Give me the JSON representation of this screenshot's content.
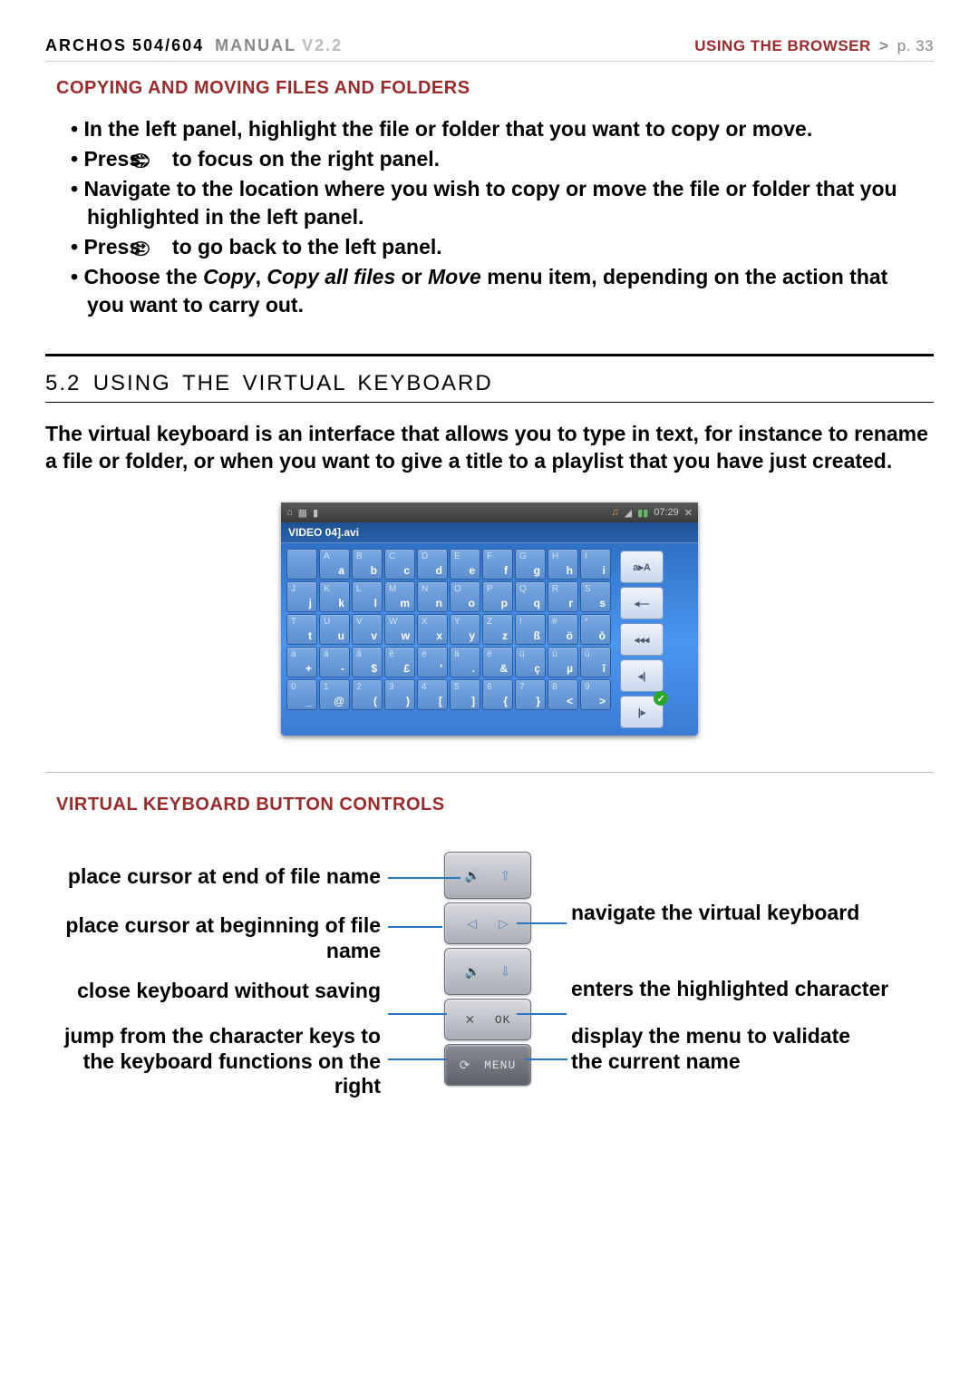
{
  "header": {
    "brand": "ARCHOS",
    "model": "504/604",
    "manual_word": "MANUAL",
    "version": "V2.2",
    "section": "USING THE BROWSER",
    "page_label": "p. 33"
  },
  "sub_heading_copy": "COPYING AND MOVING FILES AND FOLDERS",
  "bullets": [
    {
      "pre": "In the left panel, highlight the file or folder that you want to copy or move."
    },
    {
      "pre": "Press ",
      "icon": "swap",
      "post": " to focus on the right panel."
    },
    {
      "pre": "Navigate to the location where you wish to copy or move the file or folder that you highlighted in the left panel."
    },
    {
      "pre": "Press ",
      "icon": "swap",
      "post": " to go back to the left panel."
    },
    {
      "pre": "Choose the ",
      "em1": "Copy",
      "mid1": ", ",
      "em2": "Copy all files",
      "mid2": " or ",
      "em3": "Move",
      "post": " menu item, depending on the action that you want to carry out."
    }
  ],
  "section_52_num": "5.2",
  "section_52_title": "USING THE VIRTUAL KEYBOARD",
  "intro_paragraph": "The virtual keyboard is an interface that allows you to type in text, for instance to rename a file or folder, or when you want to give a title to a playlist that you have just created.",
  "vk": {
    "time": "07:29",
    "filename": "VIDEO 04].avi",
    "rows": [
      [
        [
          "",
          ""
        ],
        [
          "A",
          "a"
        ],
        [
          "B",
          "b"
        ],
        [
          "C",
          "c"
        ],
        [
          "D",
          "d"
        ],
        [
          "E",
          "e"
        ],
        [
          "F",
          "f"
        ],
        [
          "G",
          "g"
        ],
        [
          "H",
          "h"
        ],
        [
          "I",
          "i"
        ]
      ],
      [
        [
          "J",
          "j"
        ],
        [
          "K",
          "k"
        ],
        [
          "L",
          "l"
        ],
        [
          "M",
          "m"
        ],
        [
          "N",
          "n"
        ],
        [
          "O",
          "o"
        ],
        [
          "P",
          "p"
        ],
        [
          "Q",
          "q"
        ],
        [
          "R",
          "r"
        ],
        [
          "S",
          "s"
        ]
      ],
      [
        [
          "T",
          "t"
        ],
        [
          "U",
          "u"
        ],
        [
          "V",
          "v"
        ],
        [
          "W",
          "w"
        ],
        [
          "X",
          "x"
        ],
        [
          "Y",
          "y"
        ],
        [
          "Z",
          "z"
        ],
        [
          "!",
          "ß"
        ],
        [
          "#",
          "ö"
        ],
        [
          "*",
          "ō"
        ]
      ],
      [
        [
          "à",
          "+"
        ],
        [
          "á",
          "-"
        ],
        [
          "â",
          "$"
        ],
        [
          "ê",
          "£"
        ],
        [
          "è",
          "'"
        ],
        [
          "ä",
          "."
        ],
        [
          "ë",
          "&"
        ],
        [
          "ü",
          "ç"
        ],
        [
          "ù",
          "µ"
        ],
        [
          "ú",
          "î"
        ]
      ],
      [
        [
          "0",
          "_"
        ],
        [
          "1",
          "@"
        ],
        [
          "2",
          "("
        ],
        [
          "3",
          ")"
        ],
        [
          "4",
          "["
        ],
        [
          "5",
          "]"
        ],
        [
          "6",
          "{"
        ],
        [
          "7",
          "}"
        ],
        [
          "8",
          "<"
        ],
        [
          "9",
          ">"
        ]
      ]
    ],
    "side": [
      "a▸A",
      "◂—",
      "◂◂◂",
      "◂|",
      "|▸"
    ]
  },
  "sub_heading_controls": "VIRTUAL KEYBOARD BUTTON CONTROLS",
  "controls": {
    "left": [
      "place cursor at end of file name",
      "place cursor at beginning of file name",
      "close keyboard without saving",
      "jump from the character keys to the keyboard functions on the right"
    ],
    "right": [
      "navigate the virtual keyboard",
      "enters the highlighted character",
      "display the menu to validate the current name"
    ],
    "device_labels": {
      "ok": "OK",
      "menu": "MENU"
    }
  }
}
